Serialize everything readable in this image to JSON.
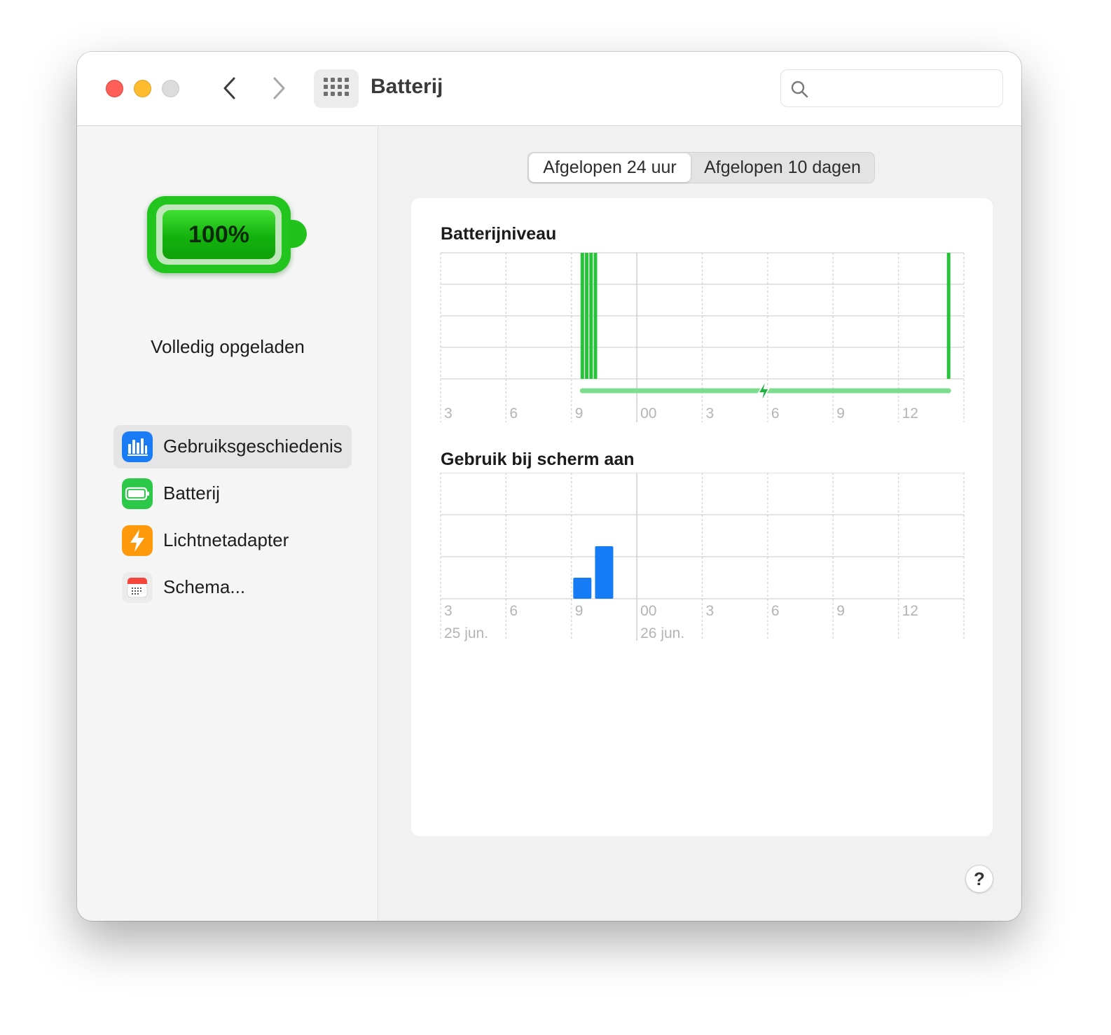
{
  "window": {
    "title": "Batterij"
  },
  "search": {
    "value": "",
    "placeholder": ""
  },
  "sidebar": {
    "battery_percent": "100%",
    "status": "Volledig opgeladen",
    "items": [
      {
        "label": "Gebruiksgeschiedenis",
        "icon": "bar-chart-icon",
        "color": "#1a7cf5",
        "selected": true
      },
      {
        "label": "Batterij",
        "icon": "battery-icon",
        "color": "#2cc84a",
        "selected": false
      },
      {
        "label": "Lichtnetadapter",
        "icon": "bolt-icon",
        "color": "#fd9a0b",
        "selected": false
      },
      {
        "label": "Schema...",
        "icon": "calendar-icon",
        "color": "#f2f2f2",
        "selected": false
      }
    ]
  },
  "tabs": [
    {
      "label": "Afgelopen 24 uur",
      "active": true
    },
    {
      "label": "Afgelopen 10 dagen",
      "active": false
    }
  ],
  "help_label": "?",
  "colors": {
    "battery_green": "#27c43a",
    "charging_green": "#7ddc8d",
    "usage_blue": "#167cf6"
  },
  "chart_data": [
    {
      "type": "bar",
      "title": "Batterijniveau",
      "x_tick_labels": [
        "3",
        "6",
        "9",
        "00",
        "3",
        "6",
        "9",
        "12"
      ],
      "x_unit": "hour",
      "ylim": [
        0,
        100
      ],
      "bars": [
        {
          "x": 9.5,
          "value": 100
        },
        {
          "x": 9.7,
          "value": 100
        },
        {
          "x": 9.9,
          "value": 100
        },
        {
          "x": 10.1,
          "value": 100
        },
        {
          "x": 26.3,
          "value": 100
        }
      ],
      "charging": {
        "from": 9.5,
        "to": 26.3,
        "marker": 17.8
      },
      "grid": true
    },
    {
      "type": "bar",
      "title": "Gebruik bij scherm aan",
      "x_tick_labels": [
        "3",
        "6",
        "9",
        "00",
        "3",
        "6",
        "9",
        "12"
      ],
      "date_labels": [
        "25 jun.",
        "26 jun."
      ],
      "x_unit": "hour",
      "ylim": [
        0,
        60
      ],
      "bars": [
        {
          "x": 9.5,
          "value": 10
        },
        {
          "x": 10.5,
          "value": 25
        }
      ],
      "grid": true
    }
  ]
}
